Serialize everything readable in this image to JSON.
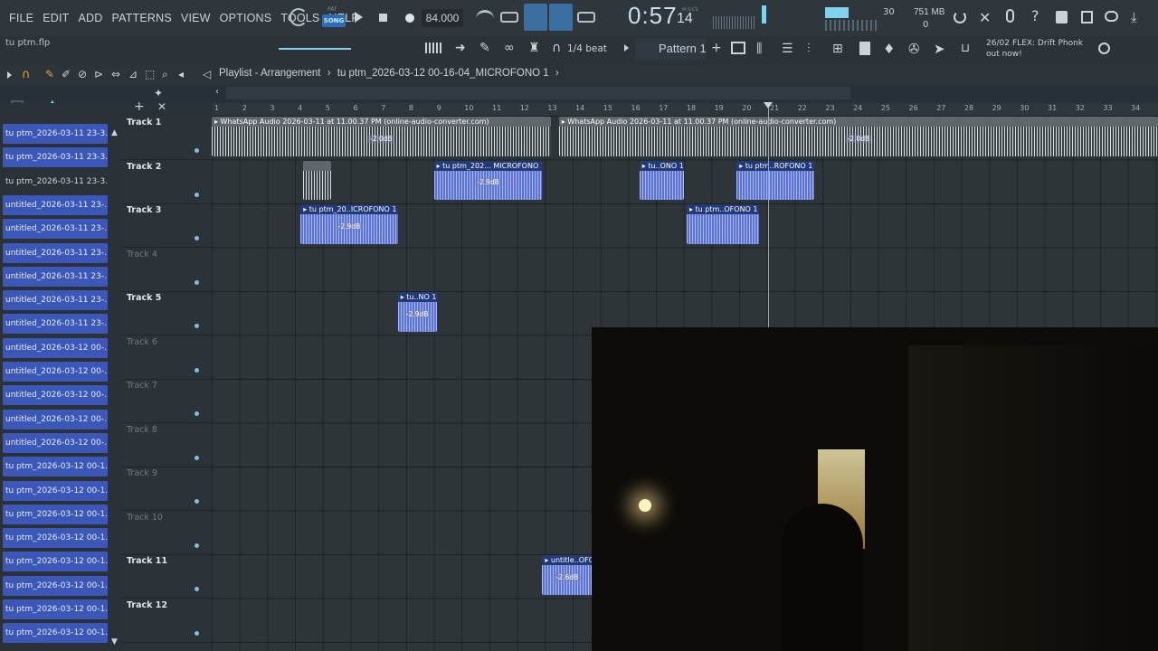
{
  "menu": [
    "FILE",
    "EDIT",
    "ADD",
    "PATTERNS",
    "VIEW",
    "OPTIONS",
    "TOOLS",
    "HELP"
  ],
  "transport": {
    "pat_label": "PAT",
    "song_label": "SONG",
    "tempo": "84.000",
    "time": "0:57",
    "time_sub": "14",
    "time_unit": "M:S:CS"
  },
  "status": {
    "poly": "30",
    "memory": "751 MB",
    "memory_sub": "0"
  },
  "file": {
    "name": "tu ptm.flp"
  },
  "toolbar2": {
    "snap": "1/4 beat",
    "pattern": "Pattern 1",
    "news_date": "26/02",
    "news_line1": "FLEX: Drift Phonk",
    "news_line2": "out now!"
  },
  "playlist": {
    "title": "Playlist - Arrangement",
    "breadcrumb_sep": "›",
    "breadcrumb": "tu  ptm_2026-03-12 00-16-04_MICROFONO 1",
    "ruler": [
      "1",
      "2",
      "3",
      "4",
      "5",
      "6",
      "7",
      "8",
      "9",
      "10",
      "11",
      "12",
      "13",
      "14",
      "15",
      "16",
      "17",
      "18",
      "19",
      "20",
      "21",
      "22",
      "23",
      "24",
      "25",
      "26",
      "27",
      "28",
      "29",
      "30",
      "31",
      "32",
      "33",
      "34"
    ]
  },
  "browser": [
    {
      "label": "tu ptm_2026-03-11 23-3...",
      "style": "blue"
    },
    {
      "label": "tu ptm_2026-03-11 23-3...",
      "style": "blue"
    },
    {
      "label": "tu ptm_2026-03-11 23-3...",
      "style": "plain"
    },
    {
      "label": "untitled_2026-03-11 23-...",
      "style": "blue"
    },
    {
      "label": "untitled_2026-03-11 23-...",
      "style": "blue"
    },
    {
      "label": "untitled_2026-03-11 23-...",
      "style": "blue"
    },
    {
      "label": "untitled_2026-03-11 23-...",
      "style": "blue"
    },
    {
      "label": "untitled_2026-03-11 23-...",
      "style": "blue"
    },
    {
      "label": "untitled_2026-03-11 23-...",
      "style": "blue"
    },
    {
      "label": "untitled_2026-03-12 00-...",
      "style": "blue"
    },
    {
      "label": "untitled_2026-03-12 00-...",
      "style": "blue"
    },
    {
      "label": "untitled_2026-03-12 00-...",
      "style": "blue"
    },
    {
      "label": "untitled_2026-03-12 00-...",
      "style": "blue"
    },
    {
      "label": "untitled_2026-03-12 00-...",
      "style": "blue"
    },
    {
      "label": "tu ptm_2026-03-12 00-1...",
      "style": "blue"
    },
    {
      "label": "tu ptm_2026-03-12 00-1...",
      "style": "blue"
    },
    {
      "label": "tu ptm_2026-03-12 00-1...",
      "style": "blue"
    },
    {
      "label": "tu ptm_2026-03-12 00-1...",
      "style": "blue"
    },
    {
      "label": "tu ptm_2026-03-12 00-1...",
      "style": "blue"
    },
    {
      "label": "tu ptm_2026-03-12 00-1...",
      "style": "blue"
    },
    {
      "label": "tu ptm_2026-03-12 00-1...",
      "style": "blue"
    },
    {
      "label": "tu ptm_2026-03-12 00-1...",
      "style": "blue"
    }
  ],
  "tracks": [
    {
      "name": "Track 1",
      "active": true
    },
    {
      "name": "Track 2",
      "active": true
    },
    {
      "name": "Track 3",
      "active": true
    },
    {
      "name": "Track 4",
      "active": false
    },
    {
      "name": "Track 5",
      "active": true
    },
    {
      "name": "Track 6",
      "active": false
    },
    {
      "name": "Track 7",
      "active": false
    },
    {
      "name": "Track 8",
      "active": false
    },
    {
      "name": "Track 9",
      "active": false
    },
    {
      "name": "Track 10",
      "active": false
    },
    {
      "name": "Track 11",
      "active": true
    },
    {
      "name": "Track 12",
      "active": true
    }
  ],
  "clips": [
    {
      "label": "WhatsApp Audio 2026-03-11 at 11.00.37 PM (online-audio-converter.com)",
      "gain": "-2.0dB",
      "color": "gray",
      "track": 1
    },
    {
      "label": "WhatsApp Audio 2026-03-11 at 11.00.37 PM (online-audio-converter.com)",
      "gain": "-2.0dB",
      "color": "gray",
      "track": 1
    },
    {
      "label": "",
      "gain": "",
      "color": "gray",
      "track": 2
    },
    {
      "label": "tu  ptm_202... MICROFONO 1",
      "gain": "-2.9dB",
      "color": "blue",
      "track": 2
    },
    {
      "label": "tu..ONO 1",
      "gain": "",
      "color": "blue",
      "track": 2
    },
    {
      "label": "tu  ptm..ROFONO 1",
      "gain": "",
      "color": "blue",
      "track": 2
    },
    {
      "label": "tu  ptm_20..ICROFONO 1",
      "gain": "-2.9dB",
      "color": "blue",
      "track": 3
    },
    {
      "label": "tu  ptm..OFONO 1",
      "gain": "",
      "color": "blue",
      "track": 3
    },
    {
      "label": "tu..NO 1",
      "gain": "-2.9dB",
      "color": "blue",
      "track": 5
    },
    {
      "label": "untitle..OFO",
      "gain": "-2.6dB",
      "color": "blue",
      "track": 11
    }
  ]
}
